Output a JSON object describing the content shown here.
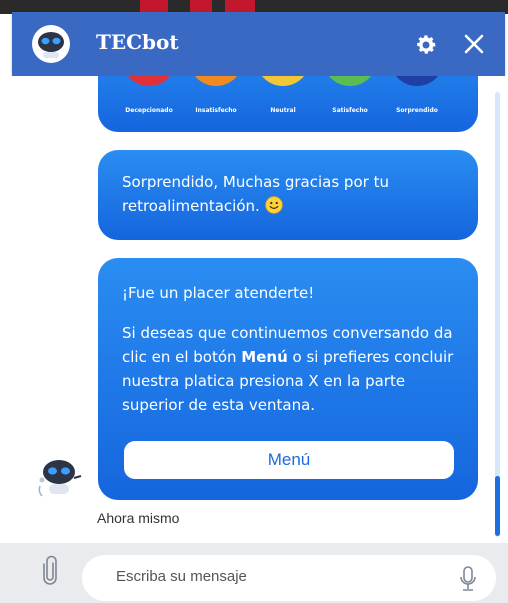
{
  "header": {
    "title": "TECbot",
    "settings_icon": "gear-icon",
    "close_icon": "close-icon",
    "accent": "#3a69c3"
  },
  "rating": {
    "options": [
      {
        "label": "Decepcionado",
        "color": "#e0313b"
      },
      {
        "label": "Insatisfecho",
        "color": "#f08a22"
      },
      {
        "label": "Neutral",
        "color": "#f1c638"
      },
      {
        "label": "Satisfecho",
        "color": "#5cbd52"
      },
      {
        "label": "Sorprendido",
        "color": "#1e3fa3"
      }
    ]
  },
  "messages": {
    "thanks": "Sorprendido, Muchas gracias por tu retroalimentación.",
    "farewell_title": "¡Fue un placer atenderte!",
    "farewell_pre": "Si deseas que continuemos conversando da clic en el botón ",
    "farewell_bold": "Menú",
    "farewell_post": " o si prefieres concluir nuestra platica presiona X en la parte superior de esta ventana.",
    "menu_button": "Menú",
    "timestamp": "Ahora mismo"
  },
  "input": {
    "placeholder": "Escriba su mensaje",
    "attach_icon": "paperclip-icon",
    "mic_icon": "microphone-icon"
  },
  "colors": {
    "bubble_top": "#2a8df1",
    "bubble_bottom": "#1565de",
    "input_bar": "#e9ebee"
  }
}
